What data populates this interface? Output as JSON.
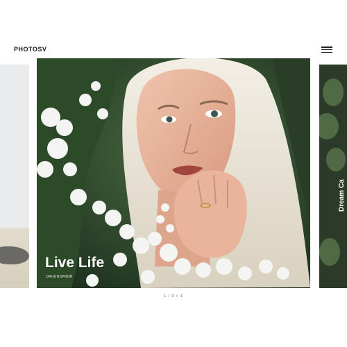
{
  "header": {
    "logo": "PHOTOSV",
    "menu_icon": "hamburger-menu-icon"
  },
  "slides": [
    {
      "position": "previous",
      "title": ""
    },
    {
      "position": "current",
      "title": "Live Life",
      "subtitle": "ORIGINSPRIMI"
    },
    {
      "position": "next",
      "title": "Dream Ca"
    }
  ],
  "pager": {
    "text": "1 / 3 + 1"
  },
  "colors": {
    "background": "#ffffff",
    "text_dark": "#1a1a1a",
    "foliage": "#2f4a2c",
    "hair": "#ede6d6",
    "skin": "#e9b9a2",
    "flowers": "#f4f4f2"
  }
}
